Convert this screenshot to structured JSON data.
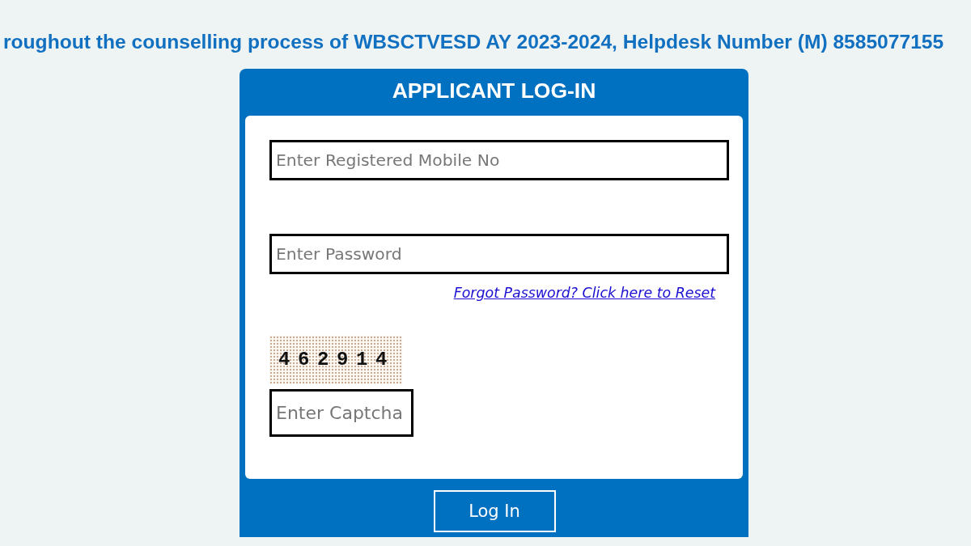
{
  "banner": {
    "text": "roughout the counselling process of WBSCTVESD AY 2023-2024, Helpdesk Number (M) 8585077155"
  },
  "login_card": {
    "title": "APPLICANT LOG-IN",
    "fields": [
      {
        "placeholder": "Enter Registered Mobile No"
      },
      {
        "placeholder": "Enter Password"
      }
    ],
    "forgot_link": "Forgot Password? Click here to Reset",
    "captcha": {
      "code": "462914",
      "placeholder": "Enter Captcha"
    },
    "submit_button": "Log In"
  }
}
